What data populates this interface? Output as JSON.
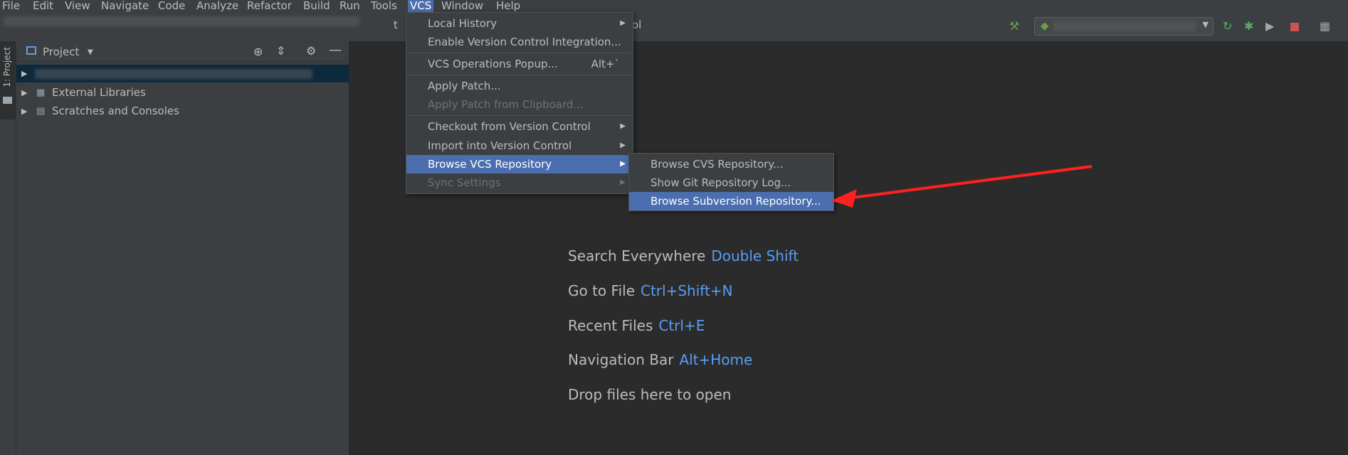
{
  "menubar": {
    "items": [
      "File",
      "Edit",
      "View",
      "Navigate",
      "Code",
      "Analyze",
      "Refactor",
      "Build",
      "Run",
      "Tools",
      "VCS",
      "Window",
      "Help"
    ],
    "active": "VCS"
  },
  "toolbar": {
    "breadcrumb_fragment_1": "t",
    "breadcrumb_fragment_2": "ol",
    "icons": [
      "build-hammer-icon",
      "run-config-icon",
      "rerun-icon",
      "debug-icon",
      "coverage-icon",
      "stop-icon",
      "project-structure-icon"
    ]
  },
  "stripe": {
    "project_tab": "1: Project"
  },
  "project_panel": {
    "title": "Project",
    "tree": [
      "External Libraries",
      "Scratches and Consoles"
    ]
  },
  "vcs_menu": {
    "items": [
      {
        "label": "Local History",
        "submenu": true,
        "enabled": true
      },
      {
        "label": "Enable Version Control Integration...",
        "enabled": true
      },
      {
        "label": "VCS Operations Popup...",
        "shortcut": "Alt+`",
        "enabled": true
      },
      {
        "label": "Apply Patch...",
        "enabled": true
      },
      {
        "label": "Apply Patch from Clipboard...",
        "enabled": false
      },
      {
        "label": "Checkout from Version Control",
        "submenu": true,
        "enabled": true
      },
      {
        "label": "Import into Version Control",
        "submenu": true,
        "enabled": true
      },
      {
        "label": "Browse VCS Repository",
        "submenu": true,
        "enabled": true,
        "highlighted": true
      },
      {
        "label": "Sync Settings",
        "submenu": true,
        "enabled": false
      }
    ]
  },
  "browse_submenu": {
    "items": [
      {
        "label": "Browse CVS Repository..."
      },
      {
        "label": "Show Git Repository Log..."
      },
      {
        "label": "Browse Subversion Repository...",
        "highlighted": true
      }
    ]
  },
  "editor_hints": [
    {
      "text": "Search Everywhere",
      "key": "Double Shift"
    },
    {
      "text": "Go to File",
      "key": "Ctrl+Shift+N"
    },
    {
      "text": "Recent Files",
      "key": "Ctrl+E"
    },
    {
      "text": "Navigation Bar",
      "key": "Alt+Home"
    },
    {
      "text": "Drop files here to open",
      "key": ""
    }
  ],
  "colors": {
    "accent": "#4b6eaf",
    "link": "#589df6",
    "annotation_arrow": "#ff2020"
  }
}
